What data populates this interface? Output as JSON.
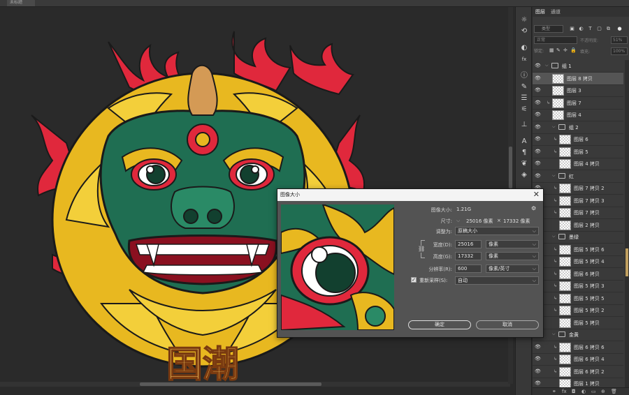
{
  "topbar": {
    "doc_tab": "未标题"
  },
  "canvas": {
    "title_text": "国潮",
    "colors": {
      "gold": "#e8b820",
      "red": "#e0283c",
      "green": "#1f6e52",
      "dark_green": "#12402f",
      "bg": "#2a2a2a"
    }
  },
  "tools": [
    {
      "name": "brightness-icon",
      "glyph": "☼"
    },
    {
      "name": "history-icon",
      "glyph": "⟲"
    },
    {
      "name": "color-icon",
      "glyph": "◐"
    },
    {
      "name": "fx-icon",
      "glyph": "fx"
    },
    {
      "name": "info-icon",
      "glyph": "ⓘ"
    },
    {
      "name": "brush-icon",
      "glyph": "✎"
    },
    {
      "name": "adjust-icon",
      "glyph": "☰"
    },
    {
      "name": "sliders-icon",
      "glyph": "⚟"
    },
    {
      "name": "stamp-icon",
      "glyph": "⊥"
    },
    {
      "name": "character-icon",
      "glyph": "A"
    },
    {
      "name": "paragraph-icon",
      "glyph": "¶"
    },
    {
      "name": "glyph-icon",
      "glyph": "❦"
    },
    {
      "name": "tool-preset-icon",
      "glyph": "◈"
    }
  ],
  "layers_panel": {
    "tabs": [
      "图层",
      "通道"
    ],
    "filter_kind": "类型",
    "blend_mode": "正常",
    "opacity_label": "不透明度:",
    "opacity_value": "51%",
    "lock_label": "锁定:",
    "fill_label": "填充:",
    "fill_value": "100%",
    "layers": [
      {
        "type": "group",
        "name": "组 1",
        "indent": 0
      },
      {
        "type": "layer",
        "name": "图层 8 拷贝",
        "indent": 0,
        "selected": true
      },
      {
        "type": "layer",
        "name": "图层 3",
        "indent": 0
      },
      {
        "type": "layer",
        "name": "图层 7",
        "indent": 0,
        "clip": true
      },
      {
        "type": "layer",
        "name": "图层 4",
        "indent": 0
      },
      {
        "type": "group",
        "name": "组 2",
        "indent": 1
      },
      {
        "type": "layer",
        "name": "图层 6",
        "indent": 1,
        "clip": true
      },
      {
        "type": "layer",
        "name": "图层 5",
        "indent": 1,
        "clip": true
      },
      {
        "type": "layer",
        "name": "图层 4 拷贝",
        "indent": 1
      },
      {
        "type": "group",
        "name": "红",
        "indent": 1
      },
      {
        "type": "layer",
        "name": "图层 7 拷贝 2",
        "indent": 1,
        "clip": true
      },
      {
        "type": "layer",
        "name": "图层 7 拷贝 3",
        "indent": 1,
        "clip": true
      },
      {
        "type": "layer",
        "name": "图层 7 拷贝",
        "indent": 1,
        "clip": true
      },
      {
        "type": "layer",
        "name": "图层 2 拷贝",
        "indent": 1
      },
      {
        "type": "group",
        "name": "墨绿",
        "indent": 1
      },
      {
        "type": "layer",
        "name": "图层 5 拷贝 6",
        "indent": 1,
        "clip": true
      },
      {
        "type": "layer",
        "name": "图层 5 拷贝 4",
        "indent": 1,
        "clip": true
      },
      {
        "type": "layer",
        "name": "图层 6 拷贝",
        "indent": 1,
        "clip": true
      },
      {
        "type": "layer",
        "name": "图层 5 拷贝 3",
        "indent": 1,
        "clip": true
      },
      {
        "type": "layer",
        "name": "图层 5 拷贝 5",
        "indent": 1,
        "clip": true
      },
      {
        "type": "layer",
        "name": "图层 5 拷贝 2",
        "indent": 1,
        "clip": true
      },
      {
        "type": "layer",
        "name": "图层 5 拷贝",
        "indent": 1
      },
      {
        "type": "group",
        "name": "金黄",
        "indent": 1
      },
      {
        "type": "layer",
        "name": "图层 6 拷贝 6",
        "indent": 1,
        "clip": true
      },
      {
        "type": "layer",
        "name": "图层 6 拷贝 4",
        "indent": 1,
        "clip": true
      },
      {
        "type": "layer",
        "name": "图层 6 拷贝 2",
        "indent": 1,
        "clip": true
      },
      {
        "type": "layer",
        "name": "图层 1 拷贝",
        "indent": 1
      }
    ]
  },
  "dialog": {
    "title": "图像大小",
    "image_size_label": "图像大小:",
    "image_size_value": "1.21G",
    "dimensions_label": "尺寸:",
    "dim_width": "25016 像素",
    "dim_x": "×",
    "dim_height": "17332 像素",
    "fit_label": "调整为:",
    "fit_value": "原稿大小",
    "width_label": "宽度(D):",
    "width_value": "25016",
    "width_unit": "像素",
    "height_label": "高度(G):",
    "height_value": "17332",
    "height_unit": "像素",
    "resolution_label": "分辨率(R):",
    "resolution_value": "600",
    "resolution_unit": "像素/英寸",
    "resample_label": "重新采样(S):",
    "resample_value": "自动",
    "resample_checked": "✓",
    "ok_label": "确定",
    "cancel_label": "取消",
    "close_glyph": "✕",
    "gear_glyph": "⚙"
  }
}
